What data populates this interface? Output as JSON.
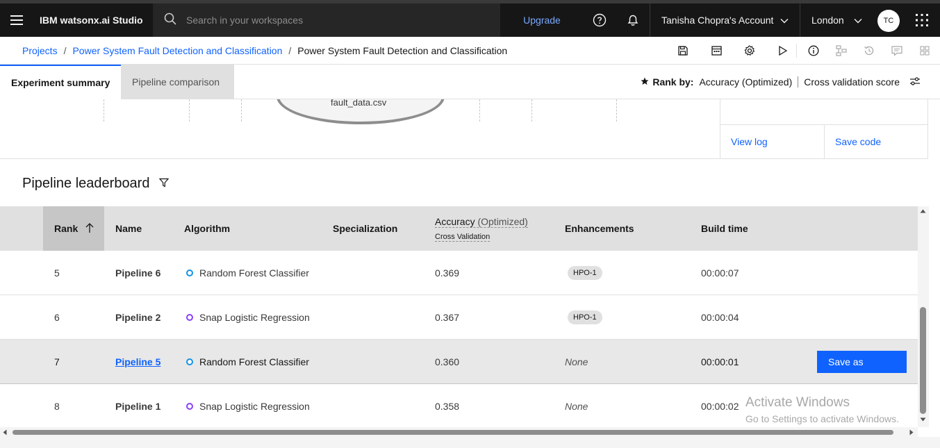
{
  "header": {
    "brand": "IBM watsonx.ai Studio",
    "search_placeholder": "Search in your workspaces",
    "upgrade_label": "Upgrade",
    "account_label": "Tanisha Chopra's Account",
    "region_label": "London",
    "avatar_initials": "TC"
  },
  "breadcrumb": {
    "items": [
      "Projects",
      "Power System Fault Detection and Classification"
    ],
    "current": "Power System Fault Detection and Classification"
  },
  "tabs": [
    {
      "label": "Experiment summary",
      "active": true
    },
    {
      "label": "Pipeline comparison",
      "active": false
    }
  ],
  "rank_by": {
    "label": "Rank by:",
    "metric": "Accuracy (Optimized)",
    "score_type": "Cross validation score"
  },
  "diagram": {
    "file_label": "fault_data.csv"
  },
  "side_panel": {
    "view_log": "View log",
    "save_code": "Save code"
  },
  "leaderboard": {
    "title": "Pipeline leaderboard",
    "columns": {
      "rank": "Rank",
      "name": "Name",
      "algorithm": "Algorithm",
      "specialization": "Specialization",
      "accuracy": "Accuracy",
      "accuracy_suffix": "(Optimized)",
      "accuracy_sub": "Cross Validation",
      "enhancements": "Enhancements",
      "build_time": "Build time"
    },
    "rows": [
      {
        "rank": "5",
        "name": "Pipeline 6",
        "algorithm": "Random Forest Classifier",
        "accuracy": "0.369",
        "enhancement": "HPO-1",
        "build_time": "00:00:07"
      },
      {
        "rank": "6",
        "name": "Pipeline 2",
        "algorithm": "Snap Logistic Regression",
        "accuracy": "0.367",
        "enhancement": "HPO-1",
        "build_time": "00:00:04"
      },
      {
        "rank": "7",
        "name": "Pipeline 5",
        "algorithm": "Random Forest Classifier",
        "accuracy": "0.360",
        "enhancement": "None",
        "build_time": "00:00:01"
      },
      {
        "rank": "8",
        "name": "Pipeline 1",
        "algorithm": "Snap Logistic Regression",
        "accuracy": "0.358",
        "enhancement": "None",
        "build_time": "00:00:02"
      }
    ],
    "save_as_label": "Save as"
  },
  "watermark": {
    "line1": "Activate Windows",
    "line2": "Go to Settings to activate Windows."
  },
  "colors": {
    "accent": "#0f62fe",
    "random_forest_dot": "#1192e8",
    "logistic_dot": "#8a3ffc"
  }
}
